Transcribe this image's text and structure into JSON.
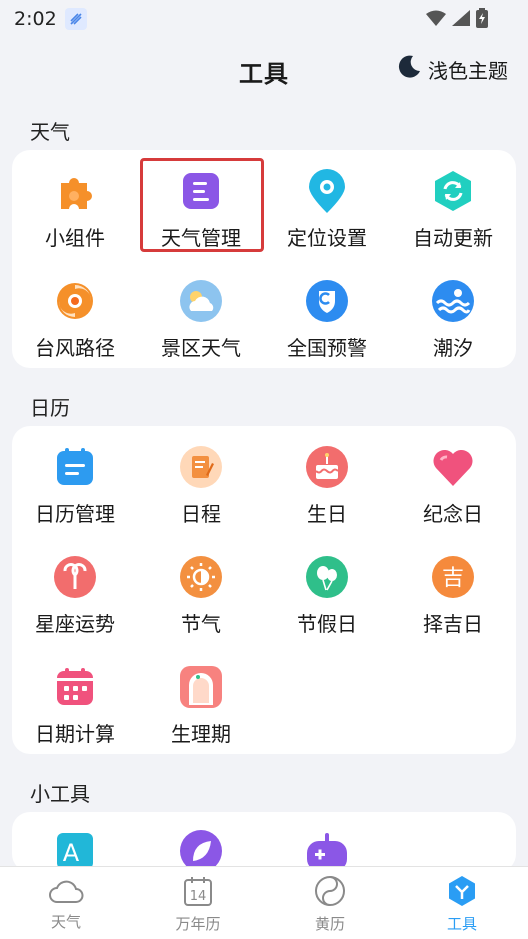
{
  "status_bar": {
    "time": "2:02"
  },
  "header": {
    "title": "工具",
    "theme_label": "浅色主题"
  },
  "sections": [
    {
      "title": "天气",
      "items": [
        {
          "label": "小组件",
          "icon": "puzzle-icon"
        },
        {
          "label": "天气管理",
          "icon": "weather-manage-icon",
          "highlighted": true
        },
        {
          "label": "定位设置",
          "icon": "location-pin-icon"
        },
        {
          "label": "自动更新",
          "icon": "refresh-icon"
        },
        {
          "label": "台风路径",
          "icon": "typhoon-icon"
        },
        {
          "label": "景区天气",
          "icon": "scenic-weather-icon"
        },
        {
          "label": "全国预警",
          "icon": "warning-shield-icon"
        },
        {
          "label": "潮汐",
          "icon": "tide-icon"
        }
      ]
    },
    {
      "title": "日历",
      "items": [
        {
          "label": "日历管理",
          "icon": "calendar-manage-icon"
        },
        {
          "label": "日程",
          "icon": "schedule-icon"
        },
        {
          "label": "生日",
          "icon": "birthday-cake-icon"
        },
        {
          "label": "纪念日",
          "icon": "heart-icon"
        },
        {
          "label": "星座运势",
          "icon": "aries-icon"
        },
        {
          "label": "节气",
          "icon": "solar-term-icon"
        },
        {
          "label": "节假日",
          "icon": "balloon-icon"
        },
        {
          "label": "择吉日",
          "icon": "lucky-day-icon"
        },
        {
          "label": "日期计算",
          "icon": "date-calc-icon"
        },
        {
          "label": "生理期",
          "icon": "period-icon"
        }
      ]
    },
    {
      "title": "小工具",
      "items": [
        {
          "label": "",
          "icon": "font-icon"
        },
        {
          "label": "",
          "icon": "leaf-icon"
        },
        {
          "label": "",
          "icon": "game-controller-icon"
        }
      ]
    }
  ],
  "tabs": [
    {
      "label": "天气",
      "icon": "cloud-icon",
      "active": false
    },
    {
      "label": "万年历",
      "icon": "calendar-14-icon",
      "active": false,
      "badge": "14"
    },
    {
      "label": "黄历",
      "icon": "yin-yang-icon",
      "active": false
    },
    {
      "label": "工具",
      "icon": "tools-icon",
      "active": true
    }
  ],
  "colors": {
    "accent": "#2a9df4",
    "highlight_border": "#d63b3b"
  }
}
